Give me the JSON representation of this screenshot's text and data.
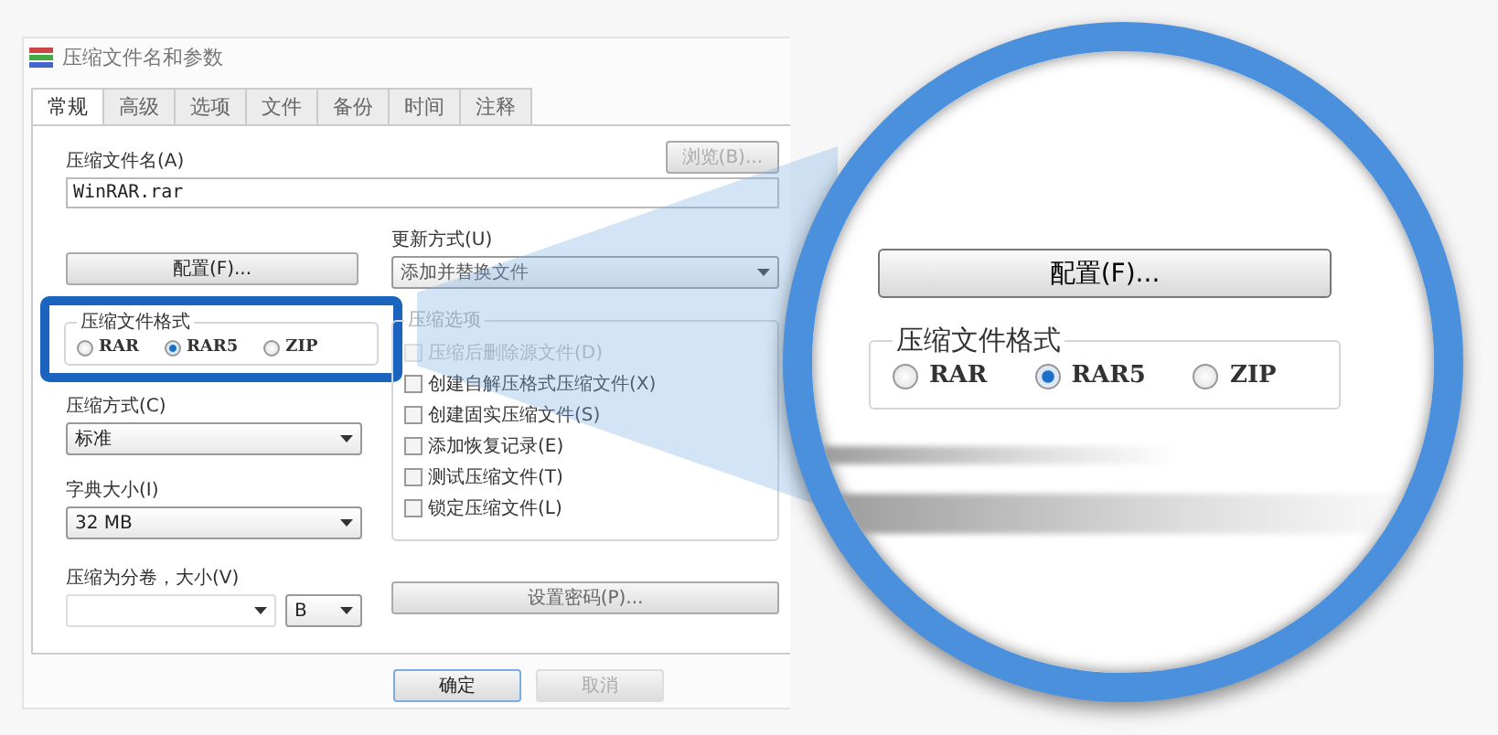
{
  "dialog": {
    "title": "压缩文件名和参数",
    "tabs": [
      {
        "label": "常规",
        "selected": true
      },
      {
        "label": "高级",
        "selected": false
      },
      {
        "label": "选项",
        "selected": false
      },
      {
        "label": "文件",
        "selected": false
      },
      {
        "label": "备份",
        "selected": false
      },
      {
        "label": "时间",
        "selected": false
      },
      {
        "label": "注释",
        "selected": false
      }
    ],
    "archive_name": {
      "label": "压缩文件名(A)",
      "value": "WinRAR.rar"
    },
    "browse_button": {
      "label": "浏览(B)...",
      "disabled": true
    },
    "profiles_button": {
      "label": "配置(F)..."
    },
    "update_mode": {
      "label": "更新方式(U)",
      "value": "添加并替换文件"
    },
    "format_group": {
      "title": "压缩文件格式",
      "options": [
        {
          "label": "RAR",
          "selected": false
        },
        {
          "label": "RAR5",
          "selected": true
        },
        {
          "label": "ZIP",
          "selected": false
        }
      ]
    },
    "method": {
      "label": "压缩方式(C)",
      "value": "标准"
    },
    "dictionary": {
      "label": "字典大小(I)",
      "value": "32 MB"
    },
    "volume": {
      "label": "压缩为分卷，大小(V)",
      "unit": "B"
    },
    "options_group": {
      "title": "压缩选项",
      "items": [
        {
          "label": "压缩后删除源文件(D)",
          "checked": false,
          "disabled": true
        },
        {
          "label": "创建自解压格式压缩文件(X)",
          "checked": false,
          "disabled": false
        },
        {
          "label": "创建固实压缩文件(S)",
          "checked": false,
          "disabled": false
        },
        {
          "label": "添加恢复记录(E)",
          "checked": false,
          "disabled": false
        },
        {
          "label": "测试压缩文件(T)",
          "checked": false,
          "disabled": false
        },
        {
          "label": "锁定压缩文件(L)",
          "checked": false,
          "disabled": false
        }
      ]
    },
    "password_button": {
      "label": "设置密码(P)..."
    },
    "buttons": [
      {
        "label": "确定",
        "disabled": false
      },
      {
        "label": "取消",
        "disabled": true
      }
    ]
  },
  "magnifier": {
    "profiles_button": {
      "label": "配置(F)..."
    },
    "format_group": {
      "title": "压缩文件格式",
      "options": [
        {
          "label": "RAR",
          "selected": false
        },
        {
          "label": "RAR5",
          "selected": true
        },
        {
          "label": "ZIP",
          "selected": false
        }
      ]
    }
  }
}
